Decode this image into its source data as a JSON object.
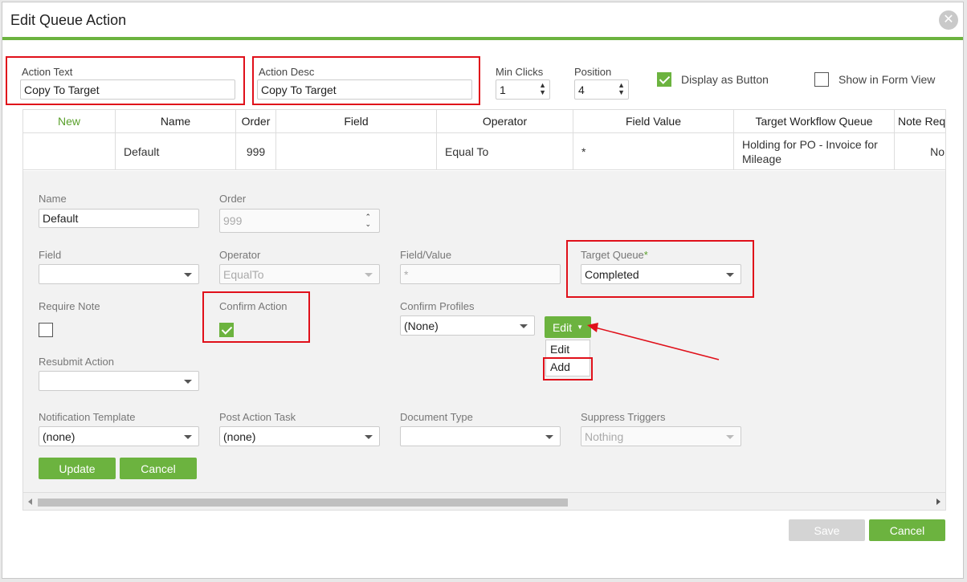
{
  "dialog": {
    "title": "Edit Queue Action",
    "close_icon": "close-icon"
  },
  "top": {
    "action_text_label": "Action Text",
    "action_text_value": "Copy To Target",
    "action_desc_label": "Action Desc",
    "action_desc_value": "Copy To Target",
    "min_clicks_label": "Min Clicks",
    "min_clicks_value": "1",
    "position_label": "Position",
    "position_value": "4",
    "display_as_button_label": "Display as Button",
    "display_as_button_checked": true,
    "show_in_form_view_label": "Show in Form View",
    "show_in_form_view_checked": false
  },
  "grid": {
    "headers": [
      "New",
      "Name",
      "Order",
      "Field",
      "Operator",
      "Field Value",
      "Target Workflow Queue",
      "Note Req"
    ],
    "row": {
      "name": "Default",
      "order": "999",
      "field": "",
      "operator": "Equal To",
      "field_value": "*",
      "target_queue_line1": "Holding for PO - Invoice for",
      "target_queue_line2": "Mileage",
      "note_req": "No"
    }
  },
  "editor": {
    "name_label": "Name",
    "name_value": "Default",
    "order_label": "Order",
    "order_value": "999",
    "field_label": "Field",
    "field_value": "",
    "operator_label": "Operator",
    "operator_value": "EqualTo",
    "field_value_label": "Field/Value",
    "field_value_value": "*",
    "target_queue_label": "Target Queue",
    "target_queue_required": "*",
    "target_queue_value": "Completed",
    "require_note_label": "Require Note",
    "require_note_checked": false,
    "confirm_action_label": "Confirm Action",
    "confirm_action_checked": true,
    "confirm_profiles_label": "Confirm Profiles",
    "confirm_profiles_value": "(None)",
    "edit_button_label": "Edit",
    "edit_menu_items": [
      "Edit",
      "Add"
    ],
    "resubmit_action_label": "Resubmit Action",
    "resubmit_action_value": "",
    "notification_template_label": "Notification Template",
    "notification_template_value": "(none)",
    "post_action_task_label": "Post Action Task",
    "post_action_task_value": "(none)",
    "document_type_label": "Document Type",
    "document_type_value": "",
    "suppress_triggers_label": "Suppress Triggers",
    "suppress_triggers_value": "Nothing",
    "update_label": "Update",
    "cancel_label": "Cancel"
  },
  "footer": {
    "save_label": "Save",
    "cancel_label": "Cancel"
  },
  "colors": {
    "accent": "#6cb33f",
    "highlight": "#e0101a"
  }
}
